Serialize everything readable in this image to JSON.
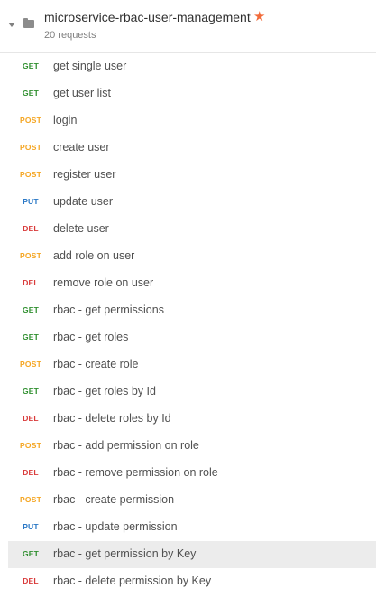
{
  "collection": {
    "name": "microservice-rbac-user-management",
    "count_label": "20 requests",
    "starred": true
  },
  "colors": {
    "GET": "#2f8f2f",
    "POST": "#f5a623",
    "PUT": "#2a78c6",
    "DEL": "#d93a3a",
    "star": "#f26b3a",
    "selected_row_bg": "#ececec"
  },
  "requests": [
    {
      "method": "GET",
      "name": "get single user"
    },
    {
      "method": "GET",
      "name": "get user list"
    },
    {
      "method": "POST",
      "name": "login"
    },
    {
      "method": "POST",
      "name": "create user"
    },
    {
      "method": "POST",
      "name": "register user"
    },
    {
      "method": "PUT",
      "name": "update user"
    },
    {
      "method": "DEL",
      "name": "delete user"
    },
    {
      "method": "POST",
      "name": "add role on user"
    },
    {
      "method": "DEL",
      "name": "remove role on user"
    },
    {
      "method": "GET",
      "name": "rbac - get permissions"
    },
    {
      "method": "GET",
      "name": "rbac - get roles"
    },
    {
      "method": "POST",
      "name": "rbac - create role"
    },
    {
      "method": "GET",
      "name": "rbac - get roles by Id"
    },
    {
      "method": "DEL",
      "name": "rbac - delete roles by Id"
    },
    {
      "method": "POST",
      "name": "rbac - add permission on role"
    },
    {
      "method": "DEL",
      "name": "rbac - remove permission on role"
    },
    {
      "method": "POST",
      "name": "rbac - create permission"
    },
    {
      "method": "PUT",
      "name": "rbac - update permission"
    },
    {
      "method": "GET",
      "name": "rbac - get permission by Key",
      "selected": true
    },
    {
      "method": "DEL",
      "name": "rbac - delete permission by Key"
    }
  ]
}
